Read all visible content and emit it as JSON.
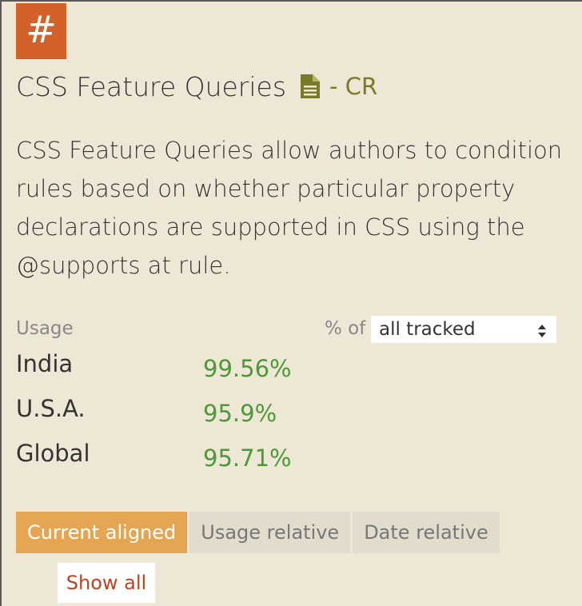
{
  "header": {
    "hash_symbol": "#",
    "title": "CSS Feature Queries",
    "status": "- CR",
    "doc_icon": "document-icon"
  },
  "description": "CSS Feature Queries allow authors to condition rules based on whether particular property declarations are supported in CSS using the @supports at rule.",
  "usage": {
    "label": "Usage",
    "pct_of_label": "% of",
    "selected_option": "all tracked",
    "rows": [
      {
        "region": "India",
        "value": "99.56%"
      },
      {
        "region": "U.S.A.",
        "value": "95.9%"
      },
      {
        "region": "Global",
        "value": "95.71%"
      }
    ]
  },
  "tabs": [
    {
      "label": "Current aligned",
      "active": true
    },
    {
      "label": "Usage relative",
      "active": false
    },
    {
      "label": "Date relative",
      "active": false
    }
  ],
  "show_all_label": "Show all",
  "colors": {
    "background": "#efe7d6",
    "hash_button": "#d3622a",
    "status": "#7a7a2a",
    "percent": "#4a9a35",
    "active_tab": "#e4a653",
    "link": "#c0421e"
  }
}
